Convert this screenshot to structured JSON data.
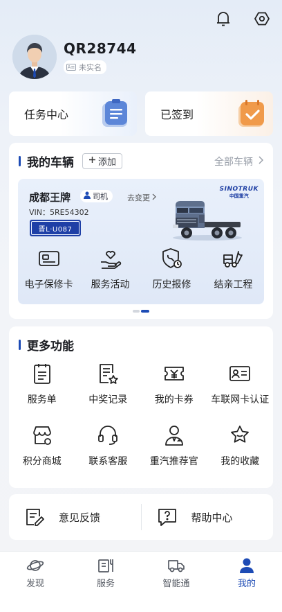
{
  "header": {
    "icons": [
      "bell-icon",
      "settings-icon"
    ]
  },
  "profile": {
    "username": "QR28744",
    "verify_badge": "未实名",
    "verify_icon_text": "A≡"
  },
  "quick_actions": [
    {
      "label": "任务中心",
      "icon": "clipboard-icon"
    },
    {
      "label": "已签到",
      "icon": "calendar-check-icon"
    }
  ],
  "vehicles": {
    "title": "我的车辆",
    "add_label": "添加",
    "all_label": "全部车辆",
    "current": {
      "name": "成都王牌",
      "role": "司机",
      "change_label": "去变更",
      "vin": "VIN：5RE54302",
      "plate": "晋L·U087",
      "brand": "SINOTRUK",
      "brand_cn": "中国重汽"
    },
    "functions": [
      {
        "label": "电子保修卡",
        "icon": "warranty-card-icon"
      },
      {
        "label": "服务活动",
        "icon": "service-hand-heart-icon"
      },
      {
        "label": "历史报修",
        "icon": "repair-history-icon"
      },
      {
        "label": "结亲工程",
        "icon": "truck-wrench-icon"
      }
    ]
  },
  "more": {
    "title": "更多功能",
    "items": [
      {
        "label": "服务单",
        "icon": "service-order-icon"
      },
      {
        "label": "中奖记录",
        "icon": "prize-record-icon"
      },
      {
        "label": "我的卡券",
        "icon": "coupon-icon"
      },
      {
        "label": "车联网卡认证",
        "icon": "id-card-icon"
      },
      {
        "label": "积分商城",
        "icon": "store-icon"
      },
      {
        "label": "联系客服",
        "icon": "headset-icon"
      },
      {
        "label": "重汽推荐官",
        "icon": "recommender-icon"
      },
      {
        "label": "我的收藏",
        "icon": "star-icon"
      }
    ]
  },
  "support": {
    "feedback_label": "意见反馈",
    "help_label": "帮助中心"
  },
  "tabs": [
    {
      "label": "发现",
      "icon": "planet-icon"
    },
    {
      "label": "服务",
      "icon": "service-tools-icon"
    },
    {
      "label": "智能通",
      "icon": "truck-icon"
    },
    {
      "label": "我的",
      "icon": "user-icon",
      "active": true
    }
  ],
  "colors": {
    "accent": "#1d4bb5",
    "plate": "#1e3fa6",
    "checkin": "#f09a4a"
  }
}
